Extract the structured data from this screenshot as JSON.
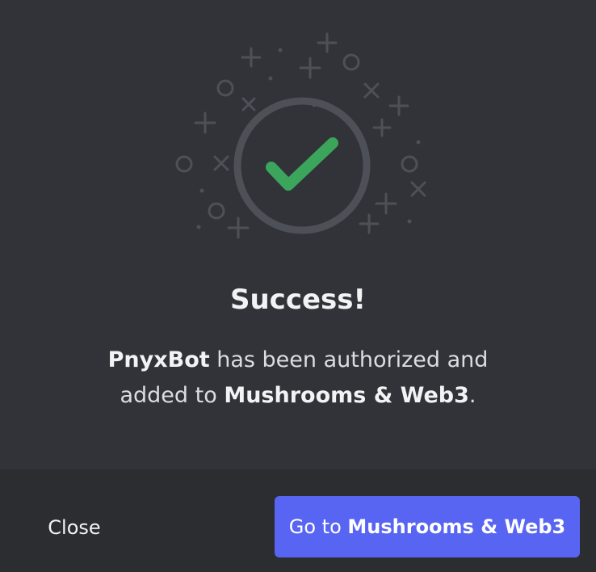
{
  "dialog": {
    "title": "Success!",
    "message": {
      "bot_name": "PnyxBot",
      "middle": " has been authorized and added to ",
      "server_name": "Mushrooms & Web3",
      "end": "."
    },
    "illustration_icon": "check-circle-icon",
    "check_color": "#3ba55c"
  },
  "footer": {
    "close_label": "Close",
    "go_prefix": "Go to ",
    "go_server": "Mushrooms & Web3"
  },
  "colors": {
    "background": "#313338",
    "footer": "#2b2d31",
    "accent": "#5865f2"
  }
}
